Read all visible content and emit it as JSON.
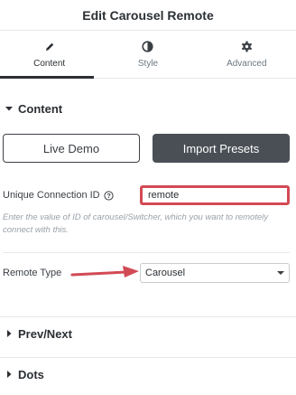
{
  "header": {
    "title": "Edit Carousel Remote"
  },
  "tabs": [
    {
      "label": "Content",
      "icon": "pencil-icon",
      "active": true
    },
    {
      "label": "Style",
      "icon": "half-circle-icon",
      "active": false
    },
    {
      "label": "Advanced",
      "icon": "gear-icon",
      "active": false
    }
  ],
  "content_section": {
    "title": "Content",
    "live_demo_label": "Live Demo",
    "import_presets_label": "Import Presets",
    "connection_id": {
      "label": "Unique Connection ID",
      "value": "remote",
      "hint": "Enter the value of ID of carousel/Switcher, which you want to remotely connect with this."
    },
    "remote_type": {
      "label": "Remote Type",
      "selected": "Carousel"
    }
  },
  "collapsed_sections": [
    {
      "title": "Prev/Next"
    },
    {
      "title": "Dots"
    }
  ],
  "colors": {
    "accent_dark": "#4a4f55",
    "highlight_red": "#d24a55"
  }
}
